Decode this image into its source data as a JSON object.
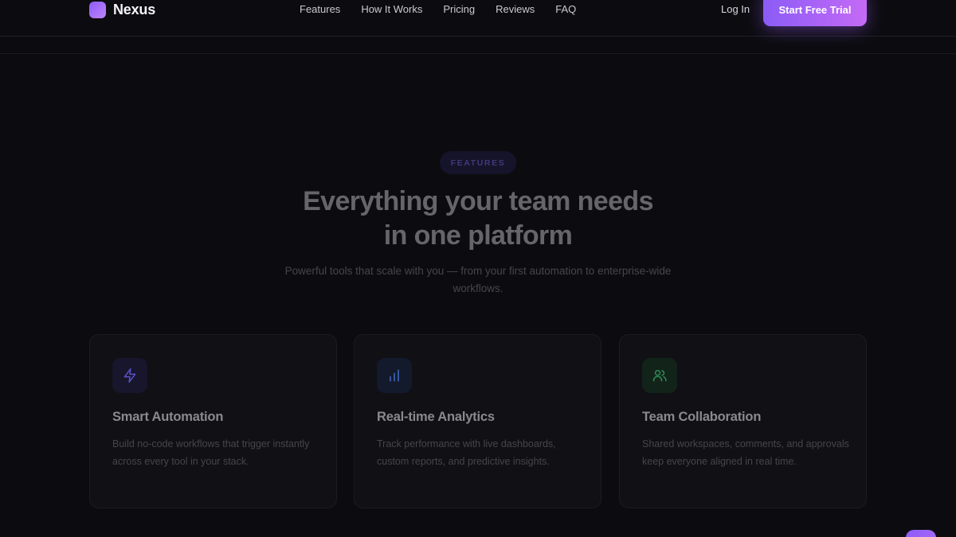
{
  "brand": {
    "name": "Nexus"
  },
  "nav": {
    "items": [
      {
        "label": "Features"
      },
      {
        "label": "How It Works"
      },
      {
        "label": "Pricing"
      },
      {
        "label": "Reviews"
      },
      {
        "label": "FAQ"
      }
    ],
    "login_label": "Log In",
    "cta_label": "Start Free Trial"
  },
  "features_section": {
    "badge": "FEATURES",
    "title_line1": "Everything your team needs",
    "title_line2": "in one platform",
    "subtitle": "Powerful tools that scale with you — from your first automation to enterprise-wide workflows.",
    "cards": [
      {
        "icon": "lightning-icon",
        "icon_color": "#5b50c8",
        "icon_bg": "#17162c",
        "title": "Smart Automation",
        "description": "Build no-code workflows that trigger instantly across every tool in your stack."
      },
      {
        "icon": "bar-chart-icon",
        "icon_color": "#3f62b3",
        "icon_bg": "#121a2c",
        "title": "Real-time Analytics",
        "description": "Track performance with live dashboards, custom reports, and predictive insights."
      },
      {
        "icon": "users-icon",
        "icon_color": "#2f8c58",
        "icon_bg": "#122319",
        "title": "Team Collaboration",
        "description": "Shared workspaces, comments, and approvals keep everyone aligned in real time."
      }
    ]
  },
  "colors": {
    "background": "#0c0c10",
    "accent_start": "#8b5cf6",
    "accent_end": "#c56af6"
  }
}
